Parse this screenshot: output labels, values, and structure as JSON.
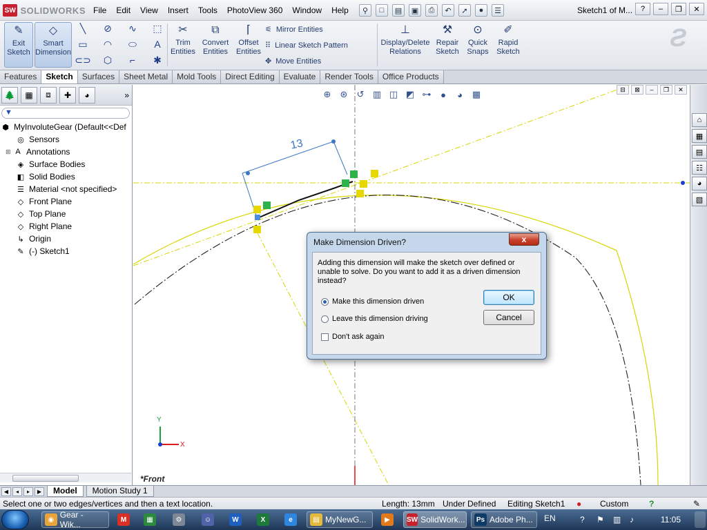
{
  "app": {
    "name": "SOLIDWORKS",
    "doc_title": "Sketch1 of M..."
  },
  "menu": [
    "File",
    "Edit",
    "View",
    "Insert",
    "Tools",
    "PhotoView 360",
    "Window",
    "Help"
  ],
  "commands": {
    "exit_sketch": "Exit Sketch",
    "smart_dimension": "Smart Dimension",
    "trim": "Trim Entities",
    "convert": "Convert Entities",
    "offset": "Offset Entities",
    "mirror": "Mirror Entities",
    "linear_pattern": "Linear Sketch Pattern",
    "move": "Move Entities",
    "display_delete": "Display/Delete Relations",
    "repair": "Repair Sketch",
    "quick_snaps": "Quick Snaps",
    "rapid_sketch": "Rapid Sketch"
  },
  "tabs": [
    "Features",
    "Sketch",
    "Surfaces",
    "Sheet Metal",
    "Mold Tools",
    "Direct Editing",
    "Evaluate",
    "Render Tools",
    "Office Products"
  ],
  "active_tab": "Sketch",
  "tree": {
    "root": "MyInvoluteGear  (Default<<Def",
    "items": [
      "Sensors",
      "Annotations",
      "Surface Bodies",
      "Solid Bodies",
      "Material <not specified>",
      "Front Plane",
      "Top Plane",
      "Right Plane",
      "Origin",
      "(-) Sketch1"
    ]
  },
  "graphics": {
    "view_label": "*Front",
    "dimension_value": "13",
    "triad_x": "X",
    "triad_y": "Y"
  },
  "bottom_tabs": [
    "Model",
    "Motion Study 1"
  ],
  "status": {
    "hint": "Select one or two edges/vertices and then a text location.",
    "length": "Length: 13mm",
    "state": "Under Defined",
    "editing": "Editing Sketch1",
    "units": "Custom"
  },
  "dialog": {
    "title": "Make Dimension Driven?",
    "close": "x",
    "message": "Adding this dimension will make the sketch over defined or unable to solve.  Do you want to add it as a driven dimension instead?",
    "option1": "Make this dimension driven",
    "option2": "Leave this dimension driving",
    "checkbox": "Don't ask again",
    "ok": "OK",
    "cancel": "Cancel"
  },
  "taskbar": {
    "items": [
      "Gear - Wik...",
      "MyNewG...",
      "SolidWork...",
      "Adobe Ph..."
    ],
    "lang": "EN",
    "time": "11:05"
  },
  "colors": {
    "accent": "#1f3c88",
    "sketch_yellow": "#d6d600",
    "dimension_blue": "#3c77c3"
  }
}
